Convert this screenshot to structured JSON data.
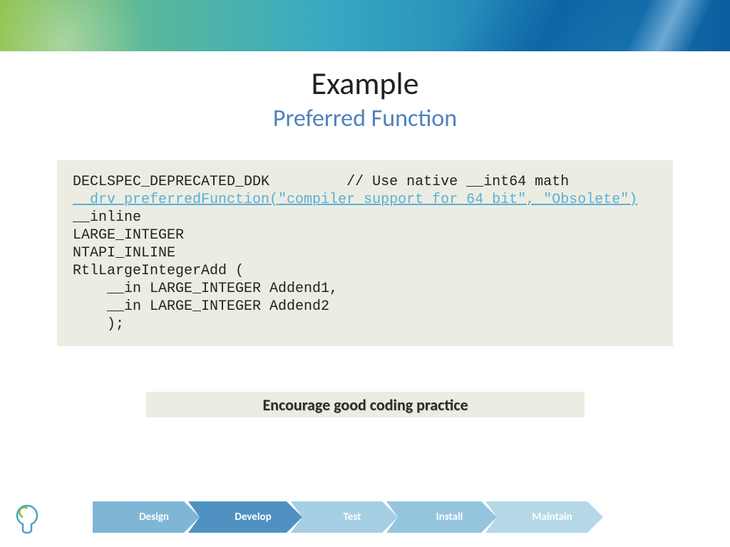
{
  "header": {
    "title": "Example",
    "subtitle": "Preferred Function"
  },
  "code": {
    "line1a": "DECLSPEC_DEPRECATED_DDK         // Use native __int64 math",
    "line2": "__drv_preferredFunction(\"compiler support for 64 bit\", \"Obsolete\")",
    "line3": "__inline",
    "line4": "LARGE_INTEGER",
    "line5": "NTAPI_INLINE",
    "line6": "RtlLargeIntegerAdd (",
    "line7": "    __in LARGE_INTEGER Addend1,",
    "line8": "    __in LARGE_INTEGER Addend2",
    "line9": "    );"
  },
  "tagline": "Encourage good coding practice",
  "footer": {
    "arrows": [
      "Design",
      "Develop",
      "Test",
      "Install",
      "Maintain"
    ],
    "colors": [
      "#7fb6d6",
      "#4f92c1",
      "#a6cfe4",
      "#95c5de",
      "#b5d8e8"
    ]
  }
}
